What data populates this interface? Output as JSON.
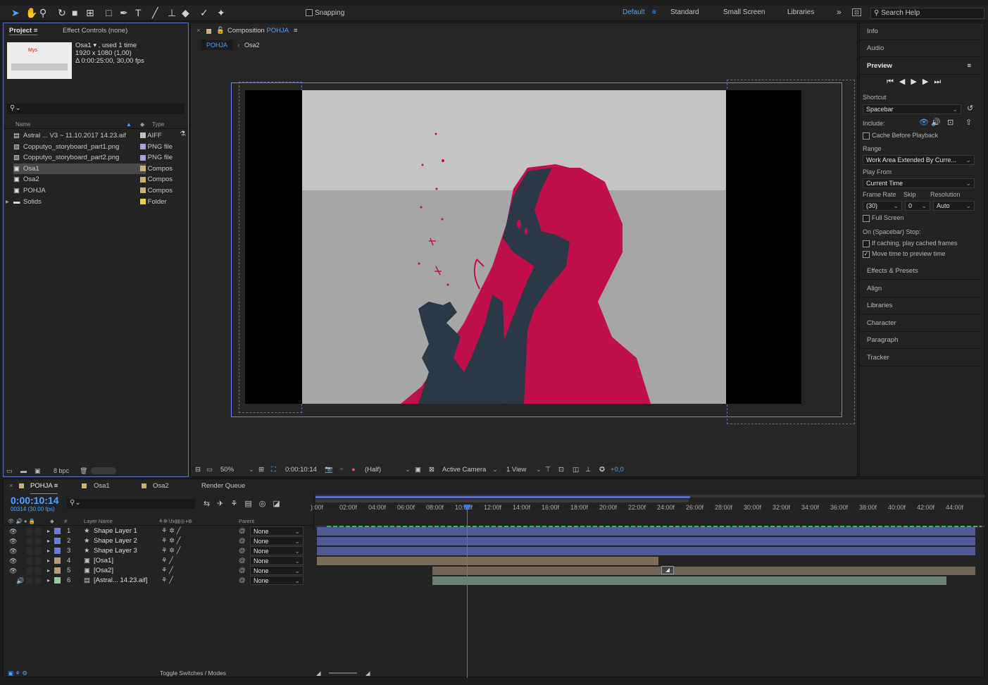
{
  "toolbar": {
    "snapping": "Snapping",
    "workspaces": [
      "Default",
      "Standard",
      "Small Screen",
      "Libraries"
    ],
    "more": "»",
    "search_placeholder": "Search Help"
  },
  "project": {
    "tab": "Project",
    "tab2": "Effect Controls (none)",
    "info_name": "Osa1 ▾ , used 1 time",
    "info_size": "1920 x 1080 (1,00)",
    "info_dur": "Δ 0:00:25:00, 30,00 fps",
    "col_name": "Name",
    "col_type": "Type",
    "items": [
      {
        "name": "Astral ... V3 ~ 11.10.2017 14.23.aif",
        "type": "AIFF",
        "color": "#c0c0c0"
      },
      {
        "name": "Copputyo_storyboard_part1.png",
        "type": "PNG file",
        "color": "#a9a4d8"
      },
      {
        "name": "Copputyo_storyboard_part2.png",
        "type": "PNG file",
        "color": "#a9a4d8"
      },
      {
        "name": "Osa1",
        "type": "Compos",
        "color": "#c7b27a"
      },
      {
        "name": "Osa2",
        "type": "Compos",
        "color": "#c7b27a"
      },
      {
        "name": "POHJA",
        "type": "Compos",
        "color": "#c7b27a"
      },
      {
        "name": "Solids",
        "type": "Folder",
        "color": "#e8d040"
      }
    ],
    "bpc": "8 bpc"
  },
  "comp": {
    "title": "Composition",
    "title_name": "POHJA",
    "crumb1": "POHJA",
    "crumb2": "Osa2",
    "zoom": "50%",
    "time": "0:00:10:14",
    "res": "(Half)",
    "camera": "Active Camera",
    "views": "1 View",
    "exposure": "+0,0"
  },
  "right": {
    "info": "Info",
    "audio": "Audio",
    "preview": "Preview",
    "shortcut_label": "Shortcut",
    "shortcut": "Spacebar",
    "include": "Include:",
    "cache": "Cache Before Playback",
    "range_label": "Range",
    "range": "Work Area Extended By Curre...",
    "playfrom_label": "Play From",
    "playfrom": "Current Time",
    "fr_label": "Frame Rate",
    "skip_label": "Skip",
    "res_label": "Resolution",
    "fr": "(30)",
    "skip": "0",
    "res": "Auto",
    "fullscreen": "Full Screen",
    "stop_label": "On (Spacebar) Stop:",
    "stop1": "If caching, play cached frames",
    "stop2": "Move time to preview time",
    "panels": [
      "Effects & Presets",
      "Align",
      "Libraries",
      "Character",
      "Paragraph",
      "Tracker"
    ]
  },
  "timeline": {
    "tab": "POHJA",
    "tab2": "Osa1",
    "tab3": "Osa2",
    "tab4": "Render Queue",
    "timecode": "0:00:10:14",
    "frames": "00314 (30.00 fps)",
    "col_layer": "Layer Name",
    "col_parent": "Parent",
    "col_num": "#",
    "ticks": [
      "):00f",
      "02:00f",
      "04:00f",
      "06:00f",
      "08:00f",
      "10:00f",
      "12:00f",
      "14:00f",
      "16:00f",
      "18:00f",
      "20:00f",
      "22:00f",
      "24:00f",
      "26:00f",
      "28:00f",
      "30:00f",
      "32:00f",
      "34:00f",
      "36:00f",
      "38:00f",
      "40:00f",
      "42:00f",
      "44:00f"
    ],
    "layers": [
      {
        "num": "1",
        "name": "Shape Layer 1",
        "color": "#6b7be0",
        "parent": "None",
        "icon": "★"
      },
      {
        "num": "2",
        "name": "Shape Layer 2",
        "color": "#6b7be0",
        "parent": "None",
        "icon": "★"
      },
      {
        "num": "3",
        "name": "Shape Layer 3",
        "color": "#6b7be0",
        "parent": "None",
        "icon": "★"
      },
      {
        "num": "4",
        "name": "[Osa1]",
        "color": "#b89b72",
        "parent": "None",
        "icon": "▣"
      },
      {
        "num": "5",
        "name": "[Osa2]",
        "color": "#b89b72",
        "parent": "None",
        "icon": "▣"
      },
      {
        "num": "6",
        "name": "[Astral... 14.23.aif]",
        "color": "#8fcf9a",
        "parent": "None",
        "icon": "▤"
      }
    ],
    "toggle": "Toggle Switches / Modes"
  }
}
